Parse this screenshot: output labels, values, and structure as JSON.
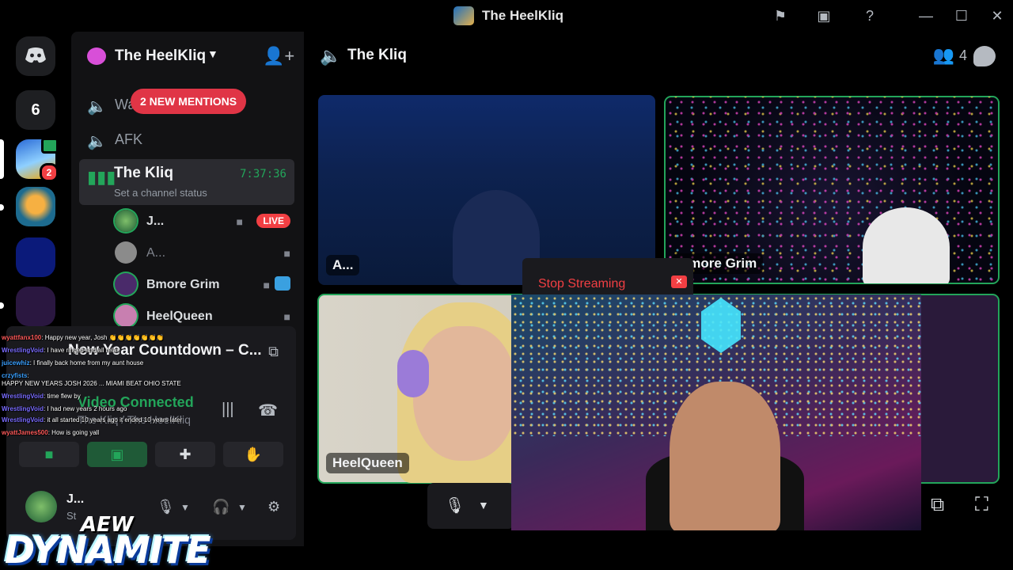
{
  "window": {
    "title": "The HeelKliq"
  },
  "rail": {
    "home_count": "6",
    "server1_badge": "2"
  },
  "sidebar": {
    "server_name": "The HeelKliq",
    "mentions_label": "2 NEW MENTIONS",
    "channels": [
      {
        "name": "Wa"
      },
      {
        "name": "AFK"
      }
    ],
    "active_channel": {
      "name": "The Kliq",
      "timer": "7:37:36",
      "status_placeholder": "Set a channel status"
    },
    "members": [
      {
        "name": "J...",
        "live": "LIVE"
      },
      {
        "name": "A..."
      },
      {
        "name": "Bmore Grim"
      },
      {
        "name": "HeelQueen"
      }
    ]
  },
  "voice_panel": {
    "activity_title": "New Year Countdown – C...",
    "connected_label": "Video Connected",
    "channel_sub": "The Kliq / The HeelKliq",
    "user_name": "J...",
    "user_status": "St"
  },
  "chat_overlay": [
    {
      "user": "wyattfanx100",
      "text": "Happy new year, Josh 👏👏👏👏👏👏👏"
    },
    {
      "user": "WrestlingVoid",
      "text": "I have ringed and all relax"
    },
    {
      "user": "juicewhiz",
      "text": "I finally back home from my aunt house"
    },
    {
      "user": "crzyfists",
      "text": ""
    },
    {
      "user": "",
      "text": "HAPPY NEW YEARS JOSH 2026 ... MIAMI BEAT OHIO STATE"
    },
    {
      "user": "WrestlingVoid",
      "text": "time flew by"
    },
    {
      "user": "WrestlingVoid",
      "text": "I had new years 2 hours ago"
    },
    {
      "user": "WrestlingVoid",
      "text": "it all started 10 years ago it ended 10 years later"
    },
    {
      "user": "wyattJames500",
      "text": "How is going yall"
    }
  ],
  "main": {
    "channel_title": "The Kliq",
    "participant_count": "4",
    "tiles": [
      {
        "label": "A..."
      },
      {
        "label": "Bmore Grim"
      },
      {
        "label": "HeelQueen"
      }
    ],
    "stop_streaming": "Stop Streaming"
  },
  "logo": {
    "small": "AEW",
    "big": "DYNAMITE"
  },
  "colors": {
    "accent_green": "#23a55a",
    "danger_red": "#f23f43",
    "background": "#000000",
    "sidebar": "#121214"
  }
}
